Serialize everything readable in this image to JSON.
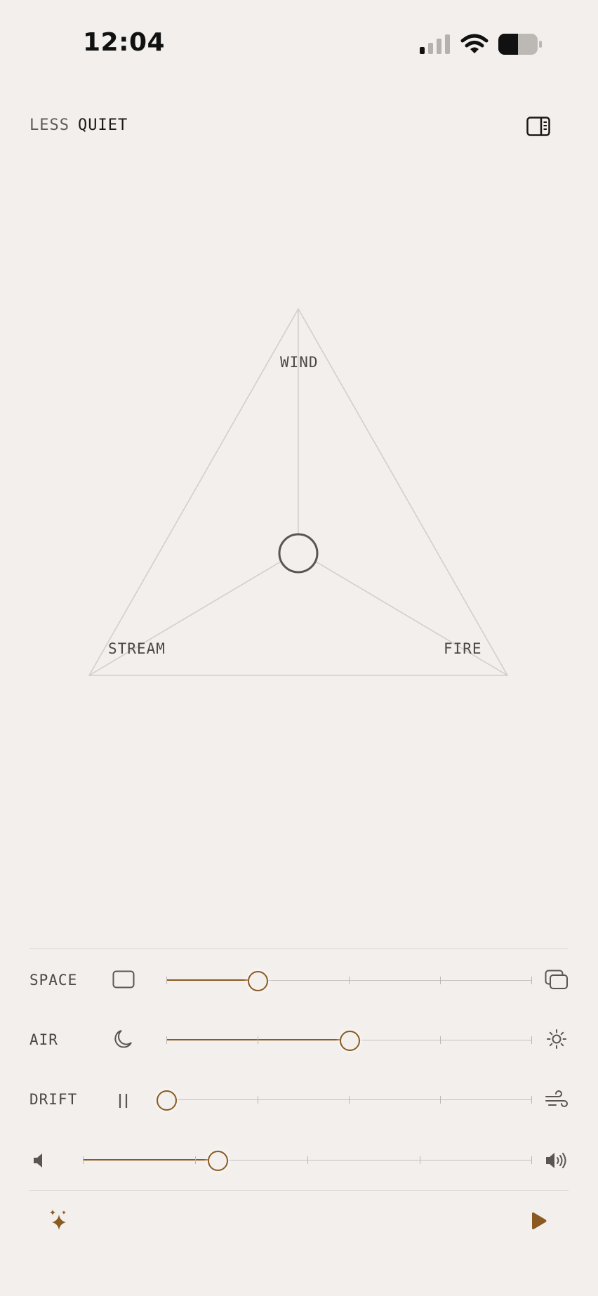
{
  "status": {
    "time": "12:04"
  },
  "header": {
    "brand_first": "LESS",
    "brand_second": "QUIET"
  },
  "mixer": {
    "labels": {
      "top": "WIND",
      "left": "STREAM",
      "right": "FIRE"
    }
  },
  "controls": {
    "space": {
      "label": "SPACE",
      "value": 0.25,
      "min_icon": "square-icon",
      "max_icon": "layers-icon"
    },
    "air": {
      "label": "AIR",
      "value": 0.5,
      "min_icon": "moon-icon",
      "max_icon": "sun-icon"
    },
    "drift": {
      "label": "DRIFT",
      "value": 0.0,
      "min_icon": "pause-bars-icon",
      "max_icon": "wind-icon"
    },
    "volume": {
      "value": 0.3,
      "min_icon": "speaker-low-icon",
      "max_icon": "speaker-high-icon"
    }
  },
  "colors": {
    "accent": "#8a5a22",
    "background": "#f2efec",
    "text": "#4a4744"
  },
  "footer": {
    "left_icon": "sparkles-icon",
    "right_icon": "play-icon"
  }
}
